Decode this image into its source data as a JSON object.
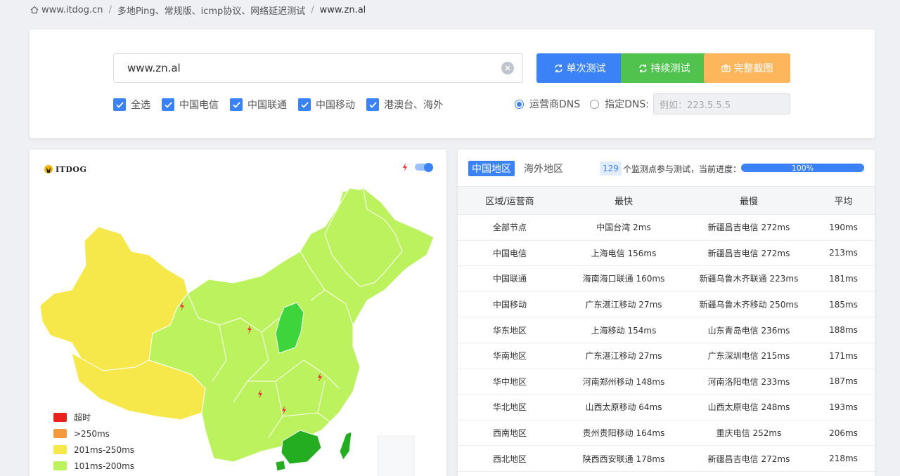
{
  "breadcrumb": {
    "home": "www.itdog.cn",
    "middle": "多地Ping、常规版、icmp协议、网络延迟测试",
    "current": "www.zn.al"
  },
  "search": {
    "value": "www.zn.al"
  },
  "buttons": {
    "single": "单次测试",
    "continuous": "持续测试",
    "screenshot": "完整截图"
  },
  "colors": {
    "primary": "#3b82f6",
    "green": "#4fc34e",
    "orange": "#fdb65c"
  },
  "checkboxes": [
    {
      "label": "全选",
      "checked": true
    },
    {
      "label": "中国电信",
      "checked": true
    },
    {
      "label": "中国联通",
      "checked": true
    },
    {
      "label": "中国移动",
      "checked": true
    },
    {
      "label": "港澳台、海外",
      "checked": true
    }
  ],
  "dns": {
    "isp_label": "运营商DNS",
    "custom_label": "指定DNS:",
    "placeholder": "例如：223.5.5.5",
    "selected": "isp"
  },
  "map": {
    "logo": "ITDOG",
    "legend": [
      {
        "label": "超时",
        "color": "#e8231e"
      },
      {
        "label": ">250ms",
        "color": "#f59a3c"
      },
      {
        "label": "201ms-250ms",
        "color": "#f6e84a"
      },
      {
        "label": "101ms-200ms",
        "color": "#bdf25f"
      }
    ]
  },
  "results": {
    "tabs": [
      "中国地区",
      "海外地区"
    ],
    "active_tab": "中国地区",
    "count": "129",
    "progress_text": "个监测点参与测试，当前进度：",
    "progress": "100%",
    "columns": [
      "区域/运营商",
      "最快",
      "最慢",
      "平均"
    ],
    "rows": [
      [
        "全部节点",
        "中国台湾 2ms",
        "新疆昌吉电信 272ms",
        "190ms"
      ],
      [
        "中国电信",
        "上海电信 156ms",
        "新疆昌吉电信 272ms",
        "213ms"
      ],
      [
        "中国联通",
        "海南海口联通 160ms",
        "新疆乌鲁木齐联通 223ms",
        "181ms"
      ],
      [
        "中国移动",
        "广东湛江移动 27ms",
        "新疆乌鲁木齐移动 250ms",
        "185ms"
      ],
      [
        "华东地区",
        "上海移动 154ms",
        "山东青岛电信 236ms",
        "188ms"
      ],
      [
        "华南地区",
        "广东湛江移动 27ms",
        "广东深圳电信 215ms",
        "171ms"
      ],
      [
        "华中地区",
        "河南郑州移动 148ms",
        "河南洛阳电信 233ms",
        "187ms"
      ],
      [
        "华北地区",
        "山西太原移动 64ms",
        "山西太原电信 248ms",
        "193ms"
      ],
      [
        "西南地区",
        "贵州贵阳移动 164ms",
        "重庆电信 252ms",
        "206ms"
      ],
      [
        "西北地区",
        "陕西西安联通 178ms",
        "新疆昌吉电信 272ms",
        "218ms"
      ]
    ]
  }
}
